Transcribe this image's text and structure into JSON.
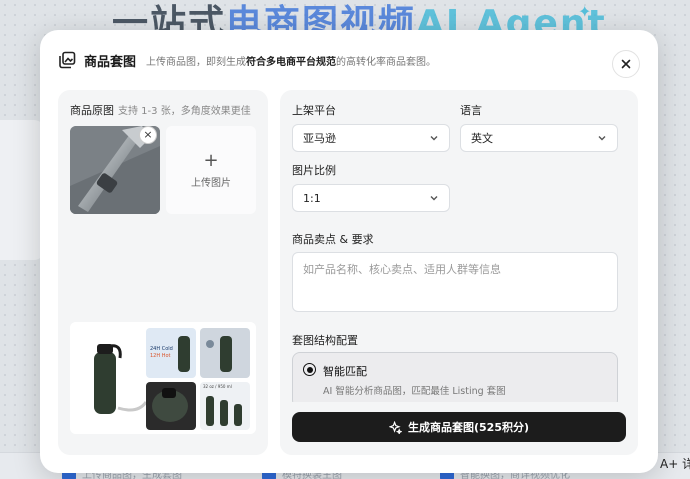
{
  "background": {
    "headline_dark": "一站式",
    "headline_blue": "电商图视频",
    "headline_cyan": "AI Agent",
    "tab1": "上传商品图，生成套图",
    "tab2": "模特换装主图",
    "tab3": "智能换图，商详视频优化",
    "corner_text": "A+ 详"
  },
  "modal": {
    "title": "商品套图",
    "desc_pre": "上传商品图，即刻生成",
    "desc_bold": "符合多电商平台规范",
    "desc_post": "的高转化率商品套图。",
    "close_icon": "close-icon"
  },
  "left": {
    "label": "商品原图",
    "hint": "支持 1-3 张，多角度效果更佳",
    "remove_symbol": "×",
    "upload_plus": "+",
    "upload_label": "上传图片",
    "example_labels": {
      "badge_line1": "24H Cold",
      "badge_line2": "12H Hot",
      "size_label": "32 oz / 950 ml"
    }
  },
  "right": {
    "platform_label": "上架平台",
    "platform_value": "亚马逊",
    "language_label": "语言",
    "language_value": "英文",
    "ratio_label": "图片比例",
    "ratio_value": "1:1",
    "selling_label": "商品卖点 & 要求",
    "selling_placeholder": "如产品名称、核心卖点、适用人群等信息",
    "structure_label": "套图结构配置",
    "option_title": "智能匹配",
    "option_desc": "AI 智能分析商品图，匹配最佳 Listing 套图",
    "generate_label": "生成商品套图(525积分)"
  },
  "colors": {
    "accent_dark": "#1c1c1c",
    "headline_blue": "#2f6bd8",
    "headline_cyan": "#36b7d8"
  }
}
